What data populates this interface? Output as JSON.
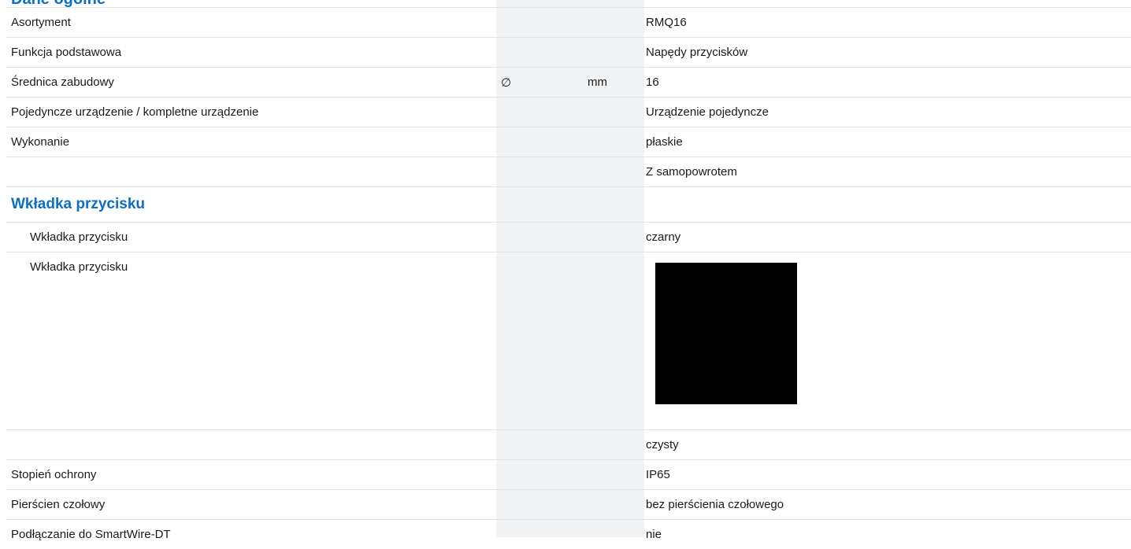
{
  "section_top": {
    "title": "Dane ogólne"
  },
  "rows_general": [
    {
      "label": "Asortyment",
      "symbol": "",
      "unit": "",
      "value": "RMQ16"
    },
    {
      "label": "Funkcja podstawowa",
      "symbol": "",
      "unit": "",
      "value": "Napędy przycisków"
    },
    {
      "label": "Średnica zabudowy",
      "symbol": "∅",
      "unit": "mm",
      "value": "16"
    },
    {
      "label": "Pojedyncze urządzenie / kompletne urządzenie",
      "symbol": "",
      "unit": "",
      "value": "Urządzenie pojedyncze"
    },
    {
      "label": "Wykonanie",
      "symbol": "",
      "unit": "",
      "value": "płaskie"
    },
    {
      "label": "",
      "symbol": "",
      "unit": "",
      "value": "Z samopowrotem"
    }
  ],
  "section_insert": {
    "title": "Wkładka przycisku",
    "rows": [
      {
        "label": "Wkładka przycisku",
        "value": "czarny"
      },
      {
        "label": "Wkładka przycisku",
        "value": "",
        "swatch_color": "#000000"
      },
      {
        "label": "",
        "value": "czysty"
      }
    ]
  },
  "rows_bottom": [
    {
      "label": "Stopień ochrony",
      "value": "IP65"
    },
    {
      "label": "Pierścien czołowy",
      "value": "bez pierścienia czołowego"
    },
    {
      "label": "Podłączanie do SmartWire-DT",
      "value": "nie"
    }
  ]
}
